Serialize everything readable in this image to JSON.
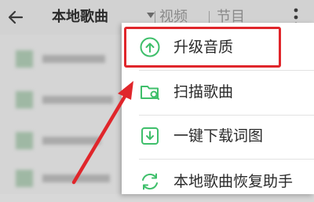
{
  "header": {
    "tabs": [
      {
        "label": "本地歌曲",
        "active": true
      },
      {
        "label": "视频",
        "active": false
      },
      {
        "label": "节目",
        "active": false
      }
    ]
  },
  "menu": {
    "items": [
      {
        "label": "升级音质",
        "icon": "upgrade-quality-icon",
        "highlighted": true
      },
      {
        "label": "扫描歌曲",
        "icon": "scan-folder-icon",
        "highlighted": false
      },
      {
        "label": "一键下载词图",
        "icon": "download-lyrics-icon",
        "highlighted": false
      },
      {
        "label": "本地歌曲恢复助手",
        "icon": "restore-icon",
        "highlighted": false
      }
    ]
  },
  "colors": {
    "accent": "#3fbf6b",
    "highlight": "#e0262b",
    "overlay": "#d5d5d5"
  }
}
